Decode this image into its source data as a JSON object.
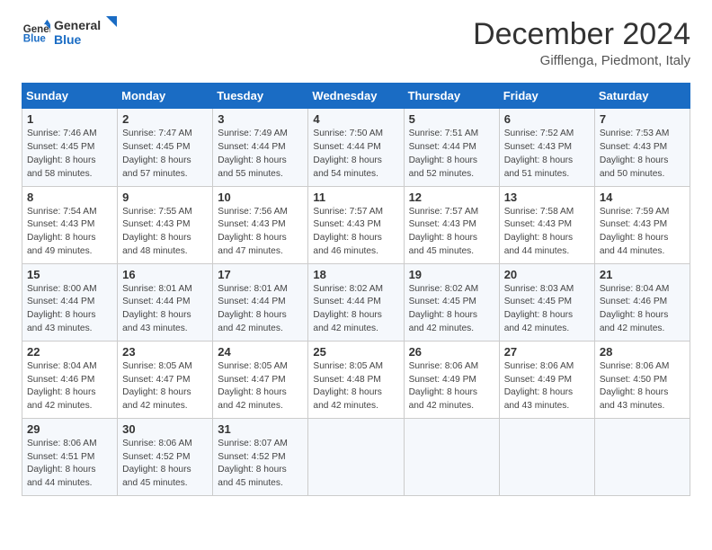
{
  "logo": {
    "line1": "General",
    "line2": "Blue"
  },
  "title": "December 2024",
  "location": "Gifflenga, Piedmont, Italy",
  "headers": [
    "Sunday",
    "Monday",
    "Tuesday",
    "Wednesday",
    "Thursday",
    "Friday",
    "Saturday"
  ],
  "weeks": [
    [
      {
        "day": "1",
        "sunrise": "7:46 AM",
        "sunset": "4:45 PM",
        "daylight": "8 hours and 58 minutes."
      },
      {
        "day": "2",
        "sunrise": "7:47 AM",
        "sunset": "4:45 PM",
        "daylight": "8 hours and 57 minutes."
      },
      {
        "day": "3",
        "sunrise": "7:49 AM",
        "sunset": "4:44 PM",
        "daylight": "8 hours and 55 minutes."
      },
      {
        "day": "4",
        "sunrise": "7:50 AM",
        "sunset": "4:44 PM",
        "daylight": "8 hours and 54 minutes."
      },
      {
        "day": "5",
        "sunrise": "7:51 AM",
        "sunset": "4:44 PM",
        "daylight": "8 hours and 52 minutes."
      },
      {
        "day": "6",
        "sunrise": "7:52 AM",
        "sunset": "4:43 PM",
        "daylight": "8 hours and 51 minutes."
      },
      {
        "day": "7",
        "sunrise": "7:53 AM",
        "sunset": "4:43 PM",
        "daylight": "8 hours and 50 minutes."
      }
    ],
    [
      {
        "day": "8",
        "sunrise": "7:54 AM",
        "sunset": "4:43 PM",
        "daylight": "8 hours and 49 minutes."
      },
      {
        "day": "9",
        "sunrise": "7:55 AM",
        "sunset": "4:43 PM",
        "daylight": "8 hours and 48 minutes."
      },
      {
        "day": "10",
        "sunrise": "7:56 AM",
        "sunset": "4:43 PM",
        "daylight": "8 hours and 47 minutes."
      },
      {
        "day": "11",
        "sunrise": "7:57 AM",
        "sunset": "4:43 PM",
        "daylight": "8 hours and 46 minutes."
      },
      {
        "day": "12",
        "sunrise": "7:57 AM",
        "sunset": "4:43 PM",
        "daylight": "8 hours and 45 minutes."
      },
      {
        "day": "13",
        "sunrise": "7:58 AM",
        "sunset": "4:43 PM",
        "daylight": "8 hours and 44 minutes."
      },
      {
        "day": "14",
        "sunrise": "7:59 AM",
        "sunset": "4:43 PM",
        "daylight": "8 hours and 44 minutes."
      }
    ],
    [
      {
        "day": "15",
        "sunrise": "8:00 AM",
        "sunset": "4:44 PM",
        "daylight": "8 hours and 43 minutes."
      },
      {
        "day": "16",
        "sunrise": "8:01 AM",
        "sunset": "4:44 PM",
        "daylight": "8 hours and 43 minutes."
      },
      {
        "day": "17",
        "sunrise": "8:01 AM",
        "sunset": "4:44 PM",
        "daylight": "8 hours and 42 minutes."
      },
      {
        "day": "18",
        "sunrise": "8:02 AM",
        "sunset": "4:44 PM",
        "daylight": "8 hours and 42 minutes."
      },
      {
        "day": "19",
        "sunrise": "8:02 AM",
        "sunset": "4:45 PM",
        "daylight": "8 hours and 42 minutes."
      },
      {
        "day": "20",
        "sunrise": "8:03 AM",
        "sunset": "4:45 PM",
        "daylight": "8 hours and 42 minutes."
      },
      {
        "day": "21",
        "sunrise": "8:04 AM",
        "sunset": "4:46 PM",
        "daylight": "8 hours and 42 minutes."
      }
    ],
    [
      {
        "day": "22",
        "sunrise": "8:04 AM",
        "sunset": "4:46 PM",
        "daylight": "8 hours and 42 minutes."
      },
      {
        "day": "23",
        "sunrise": "8:05 AM",
        "sunset": "4:47 PM",
        "daylight": "8 hours and 42 minutes."
      },
      {
        "day": "24",
        "sunrise": "8:05 AM",
        "sunset": "4:47 PM",
        "daylight": "8 hours and 42 minutes."
      },
      {
        "day": "25",
        "sunrise": "8:05 AM",
        "sunset": "4:48 PM",
        "daylight": "8 hours and 42 minutes."
      },
      {
        "day": "26",
        "sunrise": "8:06 AM",
        "sunset": "4:49 PM",
        "daylight": "8 hours and 42 minutes."
      },
      {
        "day": "27",
        "sunrise": "8:06 AM",
        "sunset": "4:49 PM",
        "daylight": "8 hours and 43 minutes."
      },
      {
        "day": "28",
        "sunrise": "8:06 AM",
        "sunset": "4:50 PM",
        "daylight": "8 hours and 43 minutes."
      }
    ],
    [
      {
        "day": "29",
        "sunrise": "8:06 AM",
        "sunset": "4:51 PM",
        "daylight": "8 hours and 44 minutes."
      },
      {
        "day": "30",
        "sunrise": "8:06 AM",
        "sunset": "4:52 PM",
        "daylight": "8 hours and 45 minutes."
      },
      {
        "day": "31",
        "sunrise": "8:07 AM",
        "sunset": "4:52 PM",
        "daylight": "8 hours and 45 minutes."
      },
      null,
      null,
      null,
      null
    ]
  ],
  "labels": {
    "sunrise": "Sunrise:",
    "sunset": "Sunset:",
    "daylight": "Daylight:"
  }
}
